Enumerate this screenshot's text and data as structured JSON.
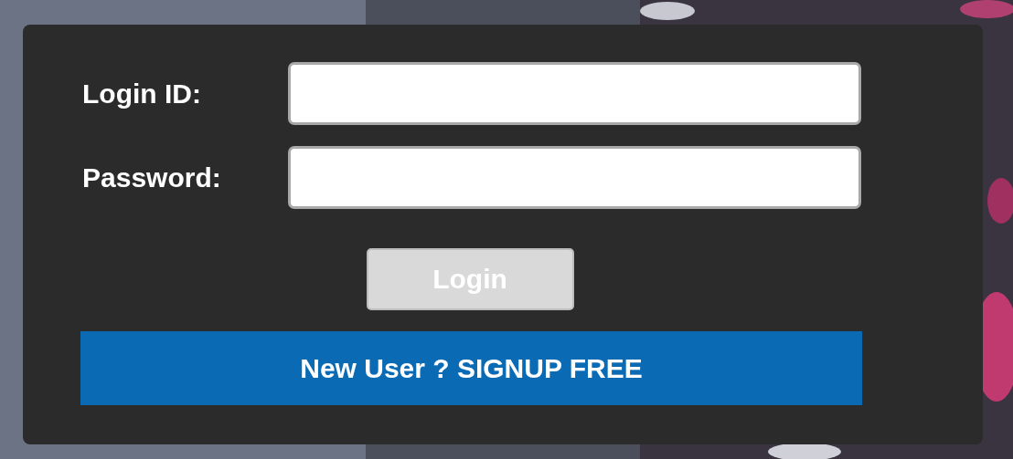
{
  "fields": [
    {
      "label": "Login ID:"
    },
    {
      "label": "Password:"
    }
  ],
  "login_button": {
    "label": "Login",
    "disabled": true
  },
  "signup_link": {
    "label": "New User ? SIGNUP FREE"
  }
}
